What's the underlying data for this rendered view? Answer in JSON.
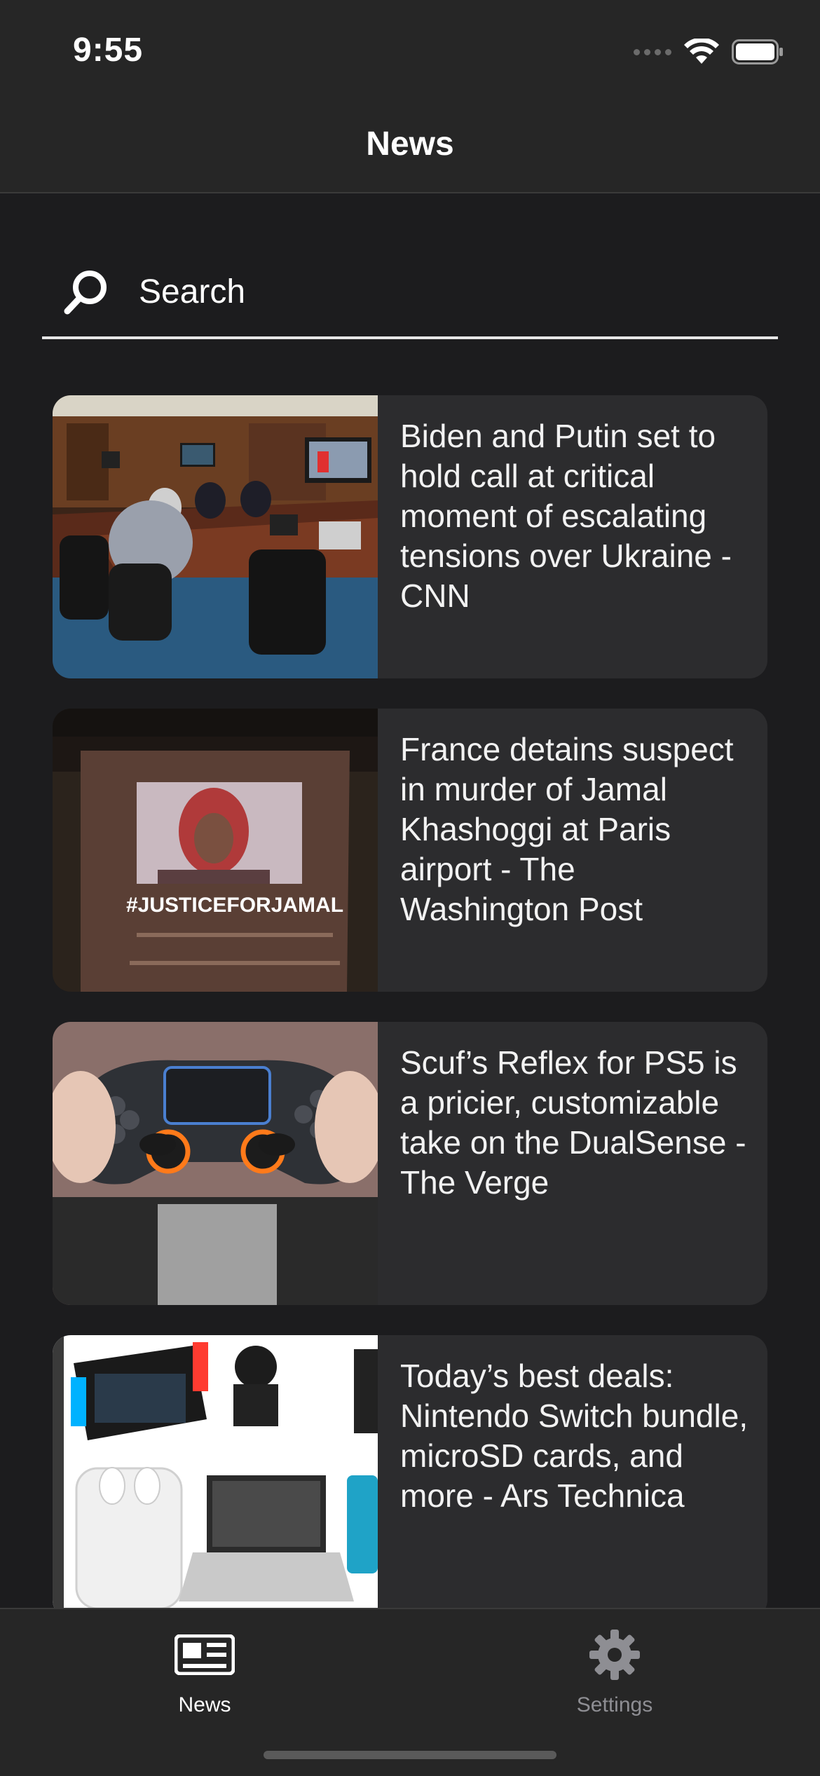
{
  "status_bar": {
    "time": "9:55",
    "icons": [
      "signal-icon",
      "wifi-icon",
      "battery-icon"
    ]
  },
  "nav": {
    "title": "News"
  },
  "search": {
    "placeholder": "Search",
    "value": "",
    "icon": "search-icon"
  },
  "articles": [
    {
      "headline": "Biden and Putin set to hold call at critical moment of escalating tensions over Ukraine - CNN",
      "image": "situation-room-photo"
    },
    {
      "headline": "France detains suspect in murder of Jamal Khashoggi at Paris airport - The Washington Post",
      "image": "justice-for-jamal-projection-photo",
      "image_text": "#JUSTICEFORJAMAL"
    },
    {
      "headline": "Scuf’s Reflex for PS5 is a pricier, customizable take on the DualSense - The Verge",
      "image": "game-controller-photo"
    },
    {
      "headline": "Today’s best deals: Nintendo Switch bundle, microSD cards, and more - Ars Technica",
      "image": "deals-products-photo"
    }
  ],
  "tabbar": {
    "tabs": [
      {
        "label": "News",
        "icon": "newspaper-icon",
        "active": true
      },
      {
        "label": "Settings",
        "icon": "gear-icon",
        "active": false
      }
    ]
  },
  "colors": {
    "background": "#1c1c1e",
    "bar": "#262626",
    "card": "#2c2c2e",
    "text": "#ffffff",
    "inactive": "#8e8e93"
  }
}
